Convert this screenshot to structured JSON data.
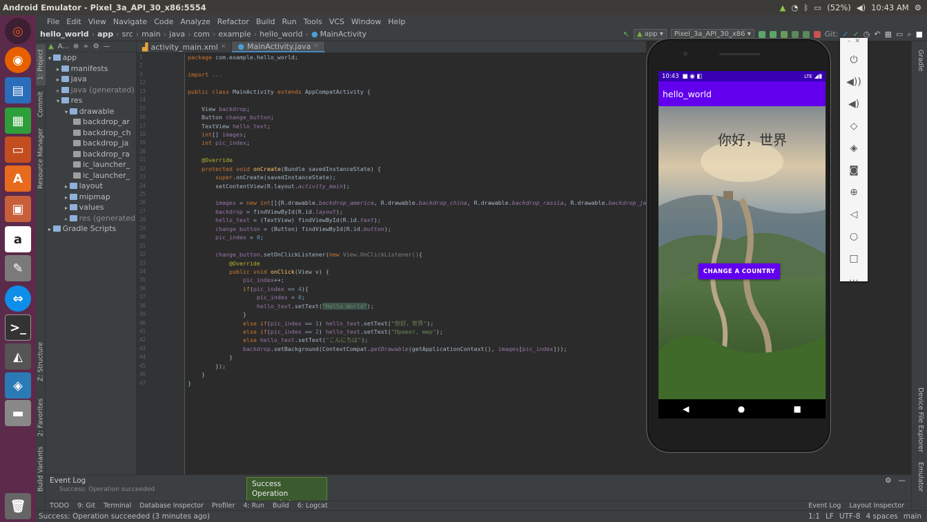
{
  "window": {
    "title": "Android Emulator - Pixel_3a_API_30_x86:5554",
    "battery": "(52%)",
    "clock": "10:43 AM"
  },
  "menu": [
    "File",
    "Edit",
    "View",
    "Navigate",
    "Code",
    "Analyze",
    "Refactor",
    "Build",
    "Run",
    "Tools",
    "VCS",
    "Window",
    "Help"
  ],
  "breadcrumb": [
    "hello_world",
    "app",
    "src",
    "main",
    "java",
    "com",
    "example",
    "hello_world",
    "MainActivity"
  ],
  "toolbar": {
    "config": "app",
    "device": "Pixel_3a_API_30_x86",
    "git": "Git:"
  },
  "project_tool": {
    "label": "A...",
    "side_labels": {
      "project": "1: Project",
      "commit": "Commit",
      "resource": "Resource Manager",
      "structure": "Z: Structure",
      "favorites": "2: Favorites",
      "build_variants": "Build Variants"
    }
  },
  "tree": [
    {
      "t": "app",
      "d": 0,
      "k": "mod"
    },
    {
      "t": "manifests",
      "d": 1,
      "k": "dir"
    },
    {
      "t": "java",
      "d": 1,
      "k": "dir"
    },
    {
      "t": "java (generated)",
      "d": 1,
      "k": "gen"
    },
    {
      "t": "res",
      "d": 1,
      "k": "dir"
    },
    {
      "t": "drawable",
      "d": 2,
      "k": "dir"
    },
    {
      "t": "backdrop_ar",
      "d": 3,
      "k": "file"
    },
    {
      "t": "backdrop_ch",
      "d": 3,
      "k": "file"
    },
    {
      "t": "backdrop_ja",
      "d": 3,
      "k": "file"
    },
    {
      "t": "backdrop_ra",
      "d": 3,
      "k": "file"
    },
    {
      "t": "ic_launcher_",
      "d": 3,
      "k": "file"
    },
    {
      "t": "ic_launcher_",
      "d": 3,
      "k": "file"
    },
    {
      "t": "layout",
      "d": 2,
      "k": "dir"
    },
    {
      "t": "mipmap",
      "d": 2,
      "k": "dir"
    },
    {
      "t": "values",
      "d": 2,
      "k": "dir"
    },
    {
      "t": "res (generated)",
      "d": 2,
      "k": "gen"
    },
    {
      "t": "Gradle Scripts",
      "d": 0,
      "k": "gradle"
    }
  ],
  "tabs": [
    {
      "label": "activity_main.xml",
      "active": false
    },
    {
      "label": "MainActivity.java",
      "active": true
    }
  ],
  "line_numbers": [
    "1",
    "2",
    "3",
    "12",
    "13",
    "14",
    "15",
    "16",
    "17",
    "18",
    "19",
    "20",
    "21",
    "22",
    "23",
    "24",
    "25",
    "26",
    "27",
    "28",
    "29",
    "30",
    "31",
    "32",
    "33",
    "34",
    "35",
    "36",
    "37",
    "38",
    "39",
    "40",
    "41",
    "42",
    "43",
    "44",
    "45",
    "46",
    "47"
  ],
  "code": [
    "<span class=\"kw\">package</span> com.example.hello_world;",
    "",
    "<span class=\"kw\">import</span> <span class=\"gr\">...</span>",
    "",
    "<span class=\"kw\">public class</span> MainActivity <span class=\"kw\">extends</span> AppCompatActivity {",
    "",
    "    View <span class=\"fd\">backdrop</span>;",
    "    Button <span class=\"fd\">change_button</span>;",
    "    TextView <span class=\"fd\">hello_text</span>;",
    "    <span class=\"kw\">int</span>[] <span class=\"fd\">images</span>;",
    "    <span class=\"kw\">int</span> <span class=\"fd\">pic_index</span>;",
    "",
    "    <span class=\"an\">@Override</span>",
    "    <span class=\"kw\">protected void</span> <span class=\"fn\">onCreate</span>(Bundle savedInstanceState) {",
    "        <span class=\"kw\">super</span>.onCreate(savedInstanceState);",
    "        setContentView(R.layout.<span class=\"it\">activity_main</span>);",
    "",
    "        <span class=\"fd\">images</span> = <span class=\"kw\">new int</span>[]{R.drawable.<span class=\"it\">backdrop_america</span>, R.drawable.<span class=\"it\">backdrop_china</span>, R.drawable.<span class=\"it\">backdrop_rassia</span>, R.drawable.<span class=\"it\">backdrop_japan</span>};",
    "        <span class=\"fd\">backdrop</span> = findViewById(R.id.<span class=\"it\">layout</span>);",
    "        <span class=\"fd\">hello_text</span> = (TextView) findViewById(R.id.<span class=\"it\">text</span>);",
    "        <span class=\"fd\">change_button</span> = (Button) findViewById(R.id.<span class=\"it\">button</span>);",
    "        <span class=\"fd\">pic_index</span> = <span class=\"num\">0</span>;",
    "",
    "        <span class=\"fd\">change_button</span>.setOnClickListener(<span class=\"kw\">new</span> <span class=\"gr\">View.OnClickListener()</span>{",
    "            <span class=\"an\">@Override</span>",
    "            <span class=\"kw\">public void</span> <span class=\"fn\">onClick</span>(View v) {",
    "                <span class=\"fd\">pic_index</span>++;",
    "                <span class=\"kw\">if</span>(<span class=\"fd\">pic_index</span> == <span class=\"num\">4</span>){",
    "                    <span class=\"fd\">pic_index</span> = <span class=\"num\">0</span>;",
    "                    <span class=\"fd\">hello_text</span>.setText(<span class=\"st hl\">\"Hello World\"</span>);",
    "                }",
    "                <span class=\"kw\">else if</span>(<span class=\"fd\">pic_index</span> == <span class=\"num\">1</span>) <span class=\"fd\">hello_text</span>.setText(<span class=\"st\">\"你好，世界\"</span>);",
    "                <span class=\"kw\">else if</span>(<span class=\"fd\">pic_index</span> == <span class=\"num\">2</span>) <span class=\"fd\">hello_text</span>.setText(<span class=\"st\">\"Привет, мир\"</span>);",
    "                <span class=\"kw\">else</span> <span class=\"fd\">hello_text</span>.setText(<span class=\"st\">\"こんにちは\"</span>);",
    "                <span class=\"fd\">backdrop</span>.setBackground(ContextCompat.<span class=\"it\">getDrawable</span>(getApplicationContext(), <span class=\"fd\">images</span>[<span class=\"fd\">pic_index</span>]));",
    "            }",
    "        });",
    "    }",
    "}"
  ],
  "device": {
    "time": "10:43",
    "signal": "LTE",
    "app_title": "hello_world",
    "hello_text": "你好，世界",
    "button_label": "CHANGE A COUNTRY"
  },
  "emulator_panel": [
    "power-icon",
    "volume-up-icon",
    "volume-down-icon",
    "rotate-left-icon",
    "rotate-right-icon",
    "camera-icon",
    "zoom-icon",
    "back-icon",
    "home-icon",
    "overview-icon",
    "more-icon"
  ],
  "right_labels": {
    "gradle": "Gradle",
    "device_file": "Device File Explorer",
    "emulator": "Emulator"
  },
  "event_log": {
    "title": "Event Log",
    "text": "Success: Operation succeeded"
  },
  "toast": {
    "title": "Success",
    "body": "Operation succeeded"
  },
  "bottom_tools": [
    "TODO",
    "9: Git",
    "Terminal",
    "Database Inspector",
    "Profiler",
    "4: Run",
    "Build",
    "6: Logcat"
  ],
  "bottom_right": [
    "Event Log",
    "Layout Inspector"
  ],
  "status": {
    "message": "Success: Operation succeeded (3 minutes ago)",
    "position": "1:1",
    "lf": "LF",
    "encoding": "UTF-8",
    "indent": "4 spaces",
    "branch": "main"
  },
  "colors": {
    "accent": "#6200ee",
    "status_bar": "#3700b3",
    "launcher": "#5c2a4b"
  }
}
